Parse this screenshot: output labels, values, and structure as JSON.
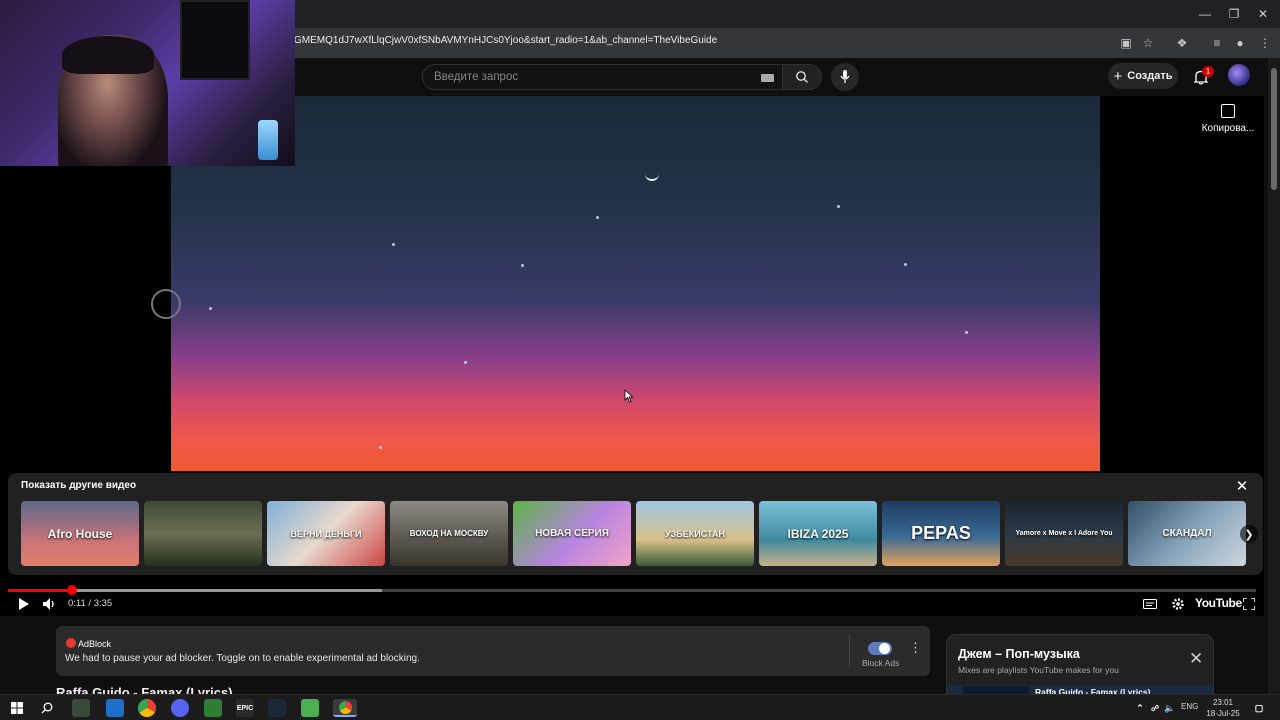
{
  "browser": {
    "url": "GMEMQ1dJ7wXfLlqCjwV0xfSNbAVMYnHJCs0Yjoo&start_radio=1&ab_channel=TheVibeGuide"
  },
  "masthead": {
    "search_placeholder": "Введите запрос",
    "create_label": "Создать",
    "notification_count": "1"
  },
  "player": {
    "copy_label": "Копирова...",
    "more_videos_title": "Показать другие видео",
    "time_display": "0:11 / 3:35",
    "progress_fraction": 0.051,
    "buffer_fraction": 0.3,
    "brand_label": "YouTube",
    "thumbnails": [
      {
        "text": "Afro House",
        "bg": "linear-gradient(180deg,#5b6a8a,#c8737a 60%,#e37f6a)"
      },
      {
        "text": "",
        "bg": "linear-gradient(180deg,#3f4a36,#6b6f52 50%,#27301f)"
      },
      {
        "text": "ВЕРНИ ДЕНЬГИ",
        "bg": "linear-gradient(135deg,#7fb0d9,#e8d8cc 50%,#c44)"
      },
      {
        "text": "ВОХОД НА МОСКВУ",
        "bg": "linear-gradient(180deg,#8c8a84,#5a564e 60%,#3a342c)"
      },
      {
        "text": "НОВАЯ СЕРИЯ",
        "bg": "linear-gradient(135deg,#5db347,#b884e0 55%,#f2a3c7)"
      },
      {
        "text": "УЗБЕКИСТАН",
        "bg": "linear-gradient(180deg,#9fc7e0,#d8c08a 60%,#3a5a3a)"
      },
      {
        "text": "IBIZA 2025",
        "bg": "linear-gradient(180deg,#7cc0d8,#3f8a9f 60%,#c8b08a)"
      },
      {
        "text": "PEPAS",
        "bg": "linear-gradient(180deg,#1e3c60,#3a6a96 55%,#e3a05a)"
      },
      {
        "text": "Yamore x Move x I Adore You",
        "bg": "linear-gradient(180deg,#1b2430,#2c3a48 50%,#4a3a2a)"
      },
      {
        "text": "СКАНДАЛ",
        "bg": "linear-gradient(135deg,#34506a,#8aa7bd 55%,#d0d6de)"
      }
    ]
  },
  "adblock": {
    "name": "AdBlock",
    "message": "We had to pause your ad blocker. Toggle on to enable experimental ad blocking.",
    "toggle_label": "Block Ads"
  },
  "video": {
    "title": "Raffa Guido - Famax (Lyrics)"
  },
  "playlist": {
    "title": "Джем – Поп-музыка",
    "subtitle": "Mixes are playlists YouTube makes for you",
    "current_item": "Raffa Guido - Famax (Lyrics)"
  },
  "taskbar": {
    "lang": "ENG",
    "time": "23:01",
    "date": "18-Jul-25"
  }
}
